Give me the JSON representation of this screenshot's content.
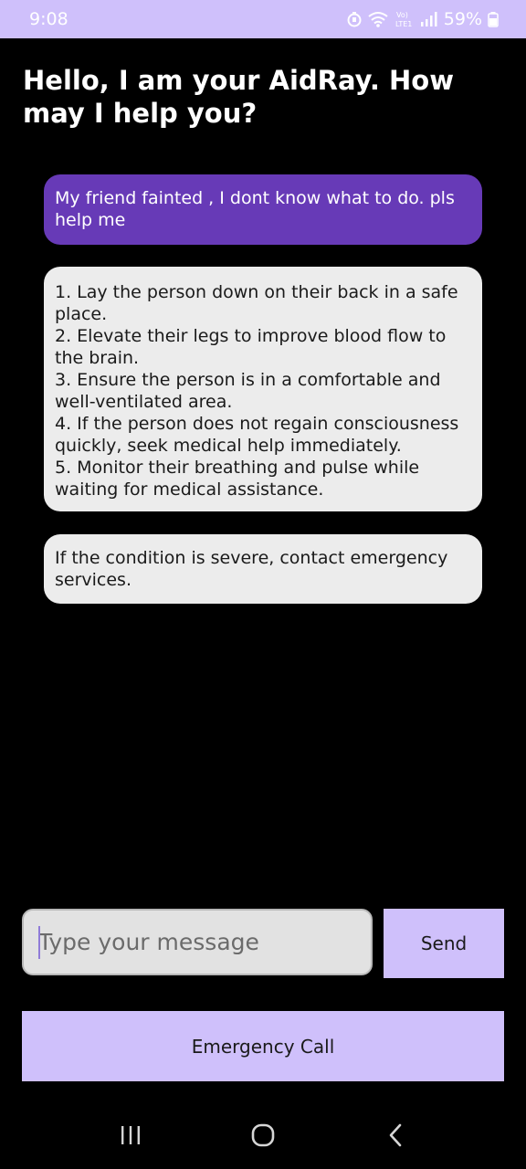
{
  "status_bar": {
    "time": "9:08",
    "network_label": "Vo) LTE1",
    "battery_percent": "59%",
    "icons": [
      "battery-saver-icon",
      "wifi-icon",
      "signal-icon",
      "battery-icon"
    ]
  },
  "header": {
    "title": "Hello, I am your AidRay. How may I help you?"
  },
  "chat": {
    "user_message": "My friend fainted , I dont know what to do. pls help me",
    "bot_message_1": [
      "1. Lay the person down on their back in a safe place.",
      "2. Elevate their legs to improve blood flow to the brain.",
      "3. Ensure the person is in a comfortable and well-ventilated area.",
      "4. If the person does not regain consciousness quickly, seek medical help immediately.",
      "5. Monitor their breathing and pulse while waiting for medical assistance."
    ],
    "bot_message_2": "If the condition is severe, contact emergency services."
  },
  "composer": {
    "placeholder": "Type your message",
    "value": "",
    "send_label": "Send"
  },
  "actions": {
    "emergency_label": "Emergency Call"
  },
  "nav_bar": {
    "icons": [
      "recent-apps-icon",
      "home-icon",
      "back-icon"
    ]
  },
  "colors": {
    "accent": "#cfc0fb",
    "user_bubble": "#673ab7",
    "bot_bubble": "#ececec",
    "background": "#000000"
  }
}
